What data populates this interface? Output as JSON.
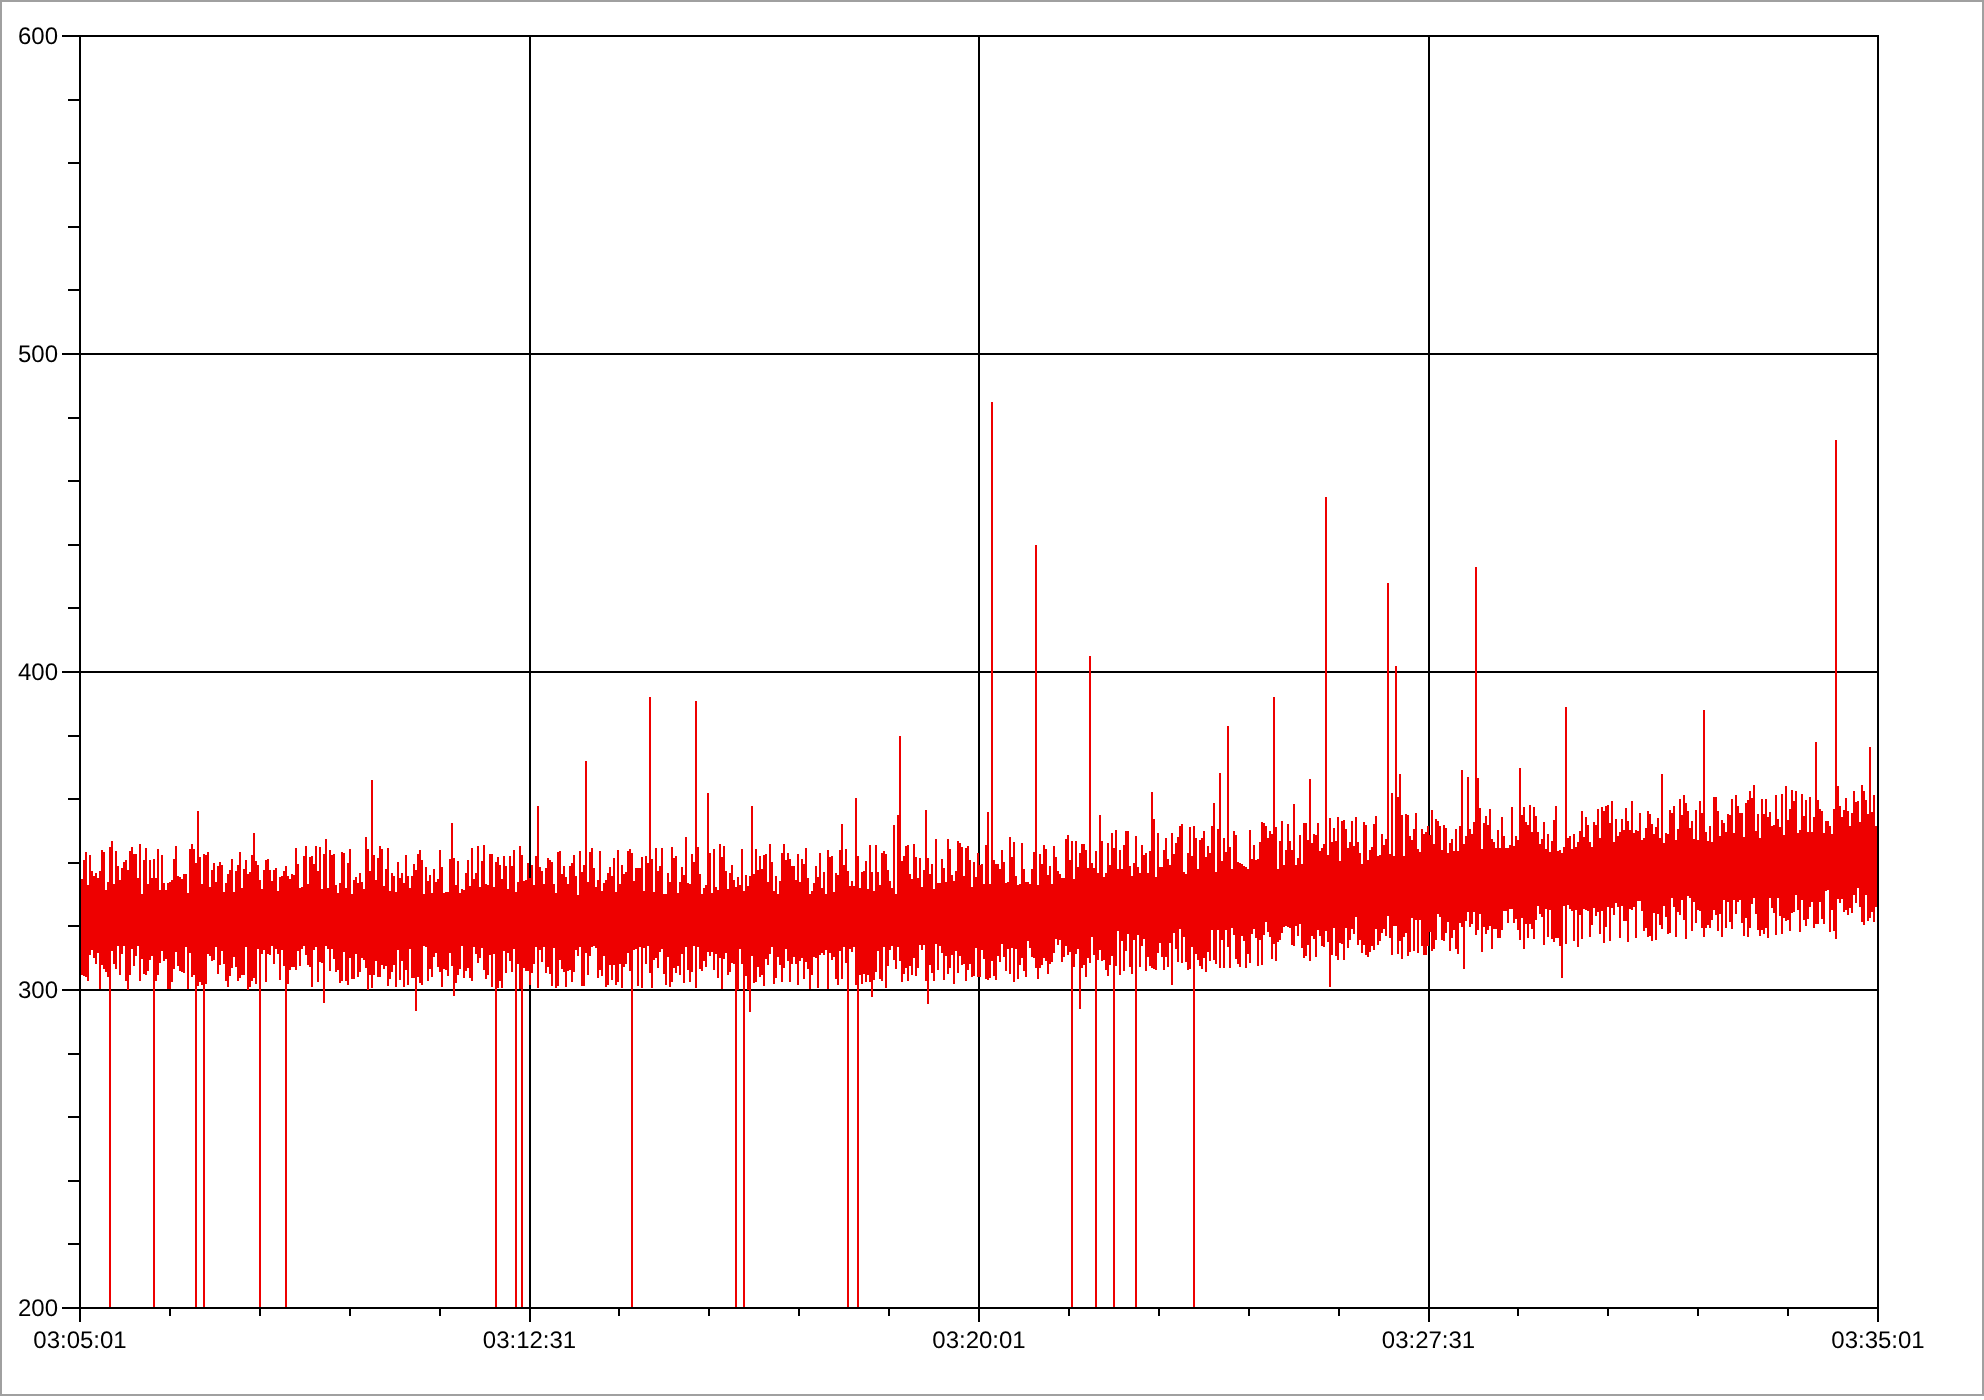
{
  "chart": {
    "y_labels": [
      "600",
      "500",
      "400",
      "300",
      "200"
    ],
    "x_labels": [
      "03:05:01",
      "03:12:31",
      "03:20:01",
      "03:27:31",
      "03:35:01"
    ]
  }
}
